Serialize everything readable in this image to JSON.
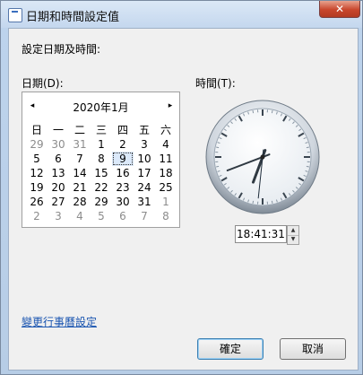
{
  "window": {
    "title": "日期和時間設定值",
    "close_label": "✕"
  },
  "heading": "設定日期及時間:",
  "date_label": "日期(D):",
  "time_label": "時間(T):",
  "calendar": {
    "month_label": "2020年1月",
    "prev_glyph": "◂",
    "next_glyph": "▸",
    "weekdays": [
      "日",
      "一",
      "二",
      "三",
      "四",
      "五",
      "六"
    ],
    "days": [
      {
        "d": "29",
        "other": true
      },
      {
        "d": "30",
        "other": true
      },
      {
        "d": "31",
        "other": true
      },
      {
        "d": "1"
      },
      {
        "d": "2"
      },
      {
        "d": "3"
      },
      {
        "d": "4"
      },
      {
        "d": "5"
      },
      {
        "d": "6"
      },
      {
        "d": "7"
      },
      {
        "d": "8"
      },
      {
        "d": "9",
        "today": true
      },
      {
        "d": "10"
      },
      {
        "d": "11"
      },
      {
        "d": "12"
      },
      {
        "d": "13"
      },
      {
        "d": "14"
      },
      {
        "d": "15"
      },
      {
        "d": "16"
      },
      {
        "d": "17"
      },
      {
        "d": "18"
      },
      {
        "d": "19"
      },
      {
        "d": "20"
      },
      {
        "d": "21"
      },
      {
        "d": "22"
      },
      {
        "d": "23"
      },
      {
        "d": "24"
      },
      {
        "d": "25"
      },
      {
        "d": "26"
      },
      {
        "d": "27"
      },
      {
        "d": "28"
      },
      {
        "d": "29"
      },
      {
        "d": "30"
      },
      {
        "d": "31"
      },
      {
        "d": "1",
        "other": true
      },
      {
        "d": "2",
        "other": true
      },
      {
        "d": "3",
        "other": true
      },
      {
        "d": "4",
        "other": true
      },
      {
        "d": "5",
        "other": true
      },
      {
        "d": "6",
        "other": true
      },
      {
        "d": "7",
        "other": true
      },
      {
        "d": "8",
        "other": true
      }
    ]
  },
  "time": {
    "value": "18:41:31",
    "hour": 18,
    "minute": 41,
    "second": 31
  },
  "spin": {
    "up": "▲",
    "down": "▼"
  },
  "link": "變更行事曆設定",
  "buttons": {
    "ok": "確定",
    "cancel": "取消"
  }
}
